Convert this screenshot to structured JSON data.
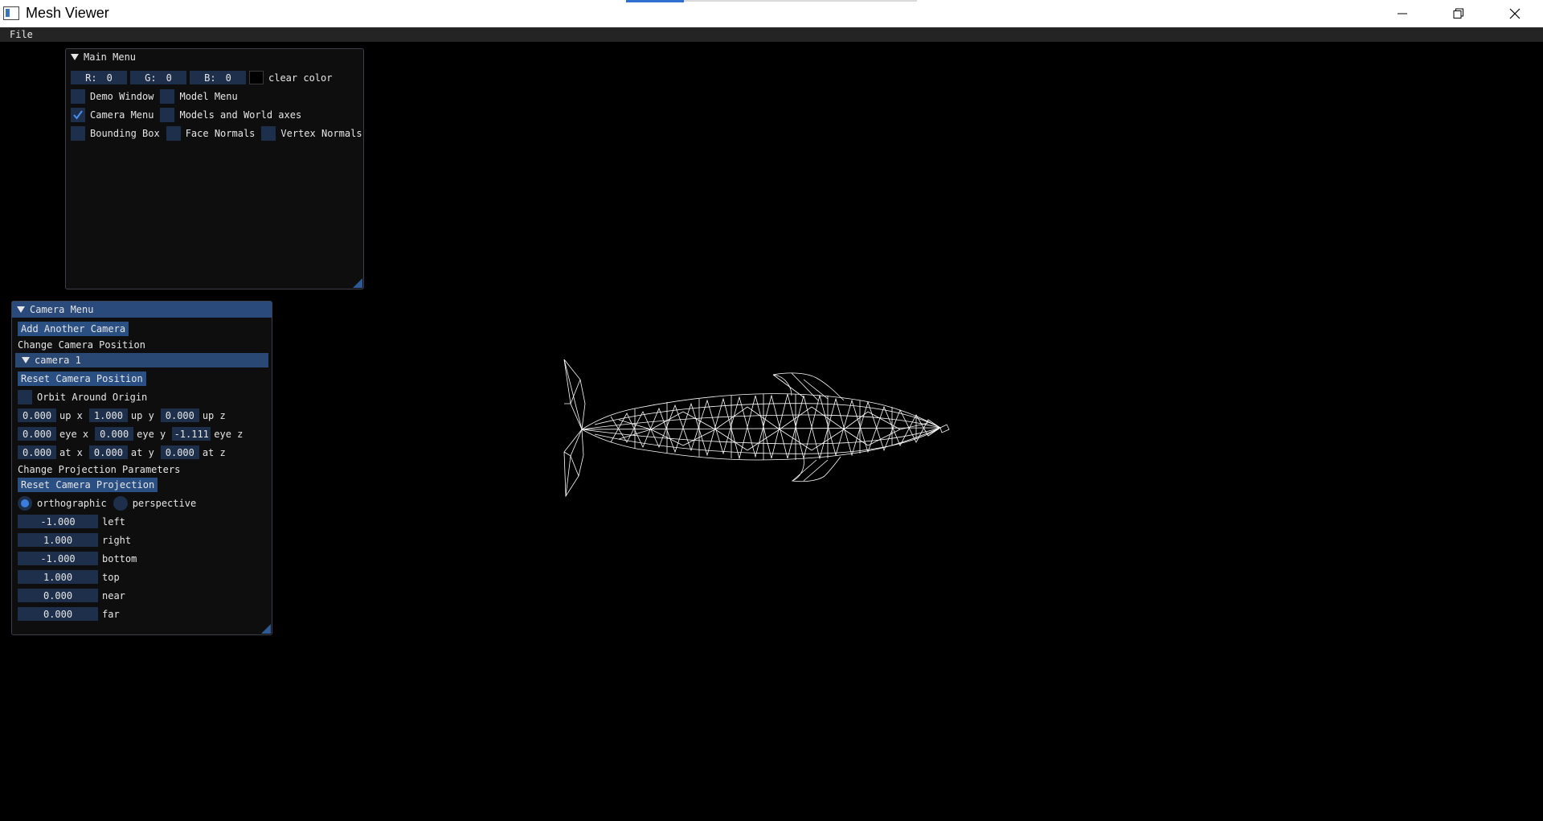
{
  "window": {
    "title": "Mesh Viewer"
  },
  "menubar": {
    "file": "File"
  },
  "main_menu": {
    "title": "Main Menu",
    "color": {
      "r_label": "R:",
      "r": "0",
      "g_label": "G:",
      "g": "0",
      "b_label": "B:",
      "b": "0",
      "clear_color_label": "clear color",
      "clear_color_value": "#000000"
    },
    "checkboxes": {
      "demo_window": {
        "label": "Demo Window",
        "checked": false
      },
      "model_menu": {
        "label": "Model Menu",
        "checked": false
      },
      "camera_menu": {
        "label": "Camera Menu",
        "checked": true
      },
      "models_world_axes": {
        "label": "Models and World axes",
        "checked": false
      },
      "bounding_box": {
        "label": "Bounding Box",
        "checked": false
      },
      "face_normals": {
        "label": "Face Normals",
        "checked": false
      },
      "vertex_normals": {
        "label": "Vertex Normals",
        "checked": false
      }
    }
  },
  "camera_menu": {
    "title": "Camera Menu",
    "add_camera": "Add Another Camera",
    "change_position_label": "Change Camera Position",
    "camera_node": "camera 1",
    "reset_position": "Reset Camera Position",
    "orbit_label": "Orbit Around Origin",
    "orbit_checked": false,
    "up": {
      "x": "0.000",
      "x_label": "up x",
      "y": "1.000",
      "y_label": "up y",
      "z": "0.000",
      "z_label": "up z"
    },
    "eye": {
      "x": "0.000",
      "x_label": "eye x",
      "y": "0.000",
      "y_label": "eye y",
      "z": "-1.111",
      "z_label": "eye z"
    },
    "at": {
      "x": "0.000",
      "x_label": "at x",
      "y": "0.000",
      "y_label": "at y",
      "z": "0.000",
      "z_label": "at z"
    },
    "projection_label": "Change Projection Parameters",
    "reset_projection": "Reset Camera Projection",
    "orthographic": "orthographic",
    "perspective": "perspective",
    "projection_selected": "orthographic",
    "params": {
      "left": {
        "value": "-1.000",
        "label": "left"
      },
      "right": {
        "value": "1.000",
        "label": "right"
      },
      "bottom": {
        "value": "-1.000",
        "label": "bottom"
      },
      "top": {
        "value": "1.000",
        "label": "top"
      },
      "near": {
        "value": "0.000",
        "label": "near"
      },
      "far": {
        "value": "0.000",
        "label": "far"
      }
    }
  },
  "colors": {
    "frame_bg": "#1d2f4a",
    "button": "#2a4f83",
    "header": "#294a7a",
    "accent": "#3a7fe0"
  },
  "viewport": {
    "model": "dolphin-wireframe-mesh"
  }
}
